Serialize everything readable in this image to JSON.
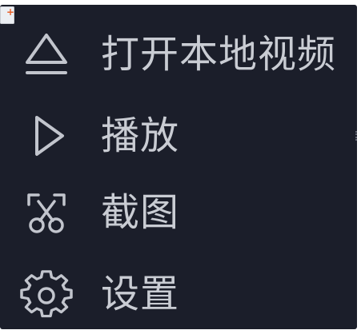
{
  "colors": {
    "panel_background": "#1b1e2a",
    "icon": "#c2c5cd",
    "text": "#c9ccd3"
  },
  "badge": {
    "icon": "add-badge-icon",
    "glyph": "+"
  },
  "menu": {
    "items": [
      {
        "label": "打开本地视频",
        "icon": "eject-icon"
      },
      {
        "label": "播放",
        "icon": "play-icon"
      },
      {
        "label": "截图",
        "icon": "scissors-icon"
      },
      {
        "label": "设置",
        "icon": "gear-icon"
      }
    ]
  }
}
